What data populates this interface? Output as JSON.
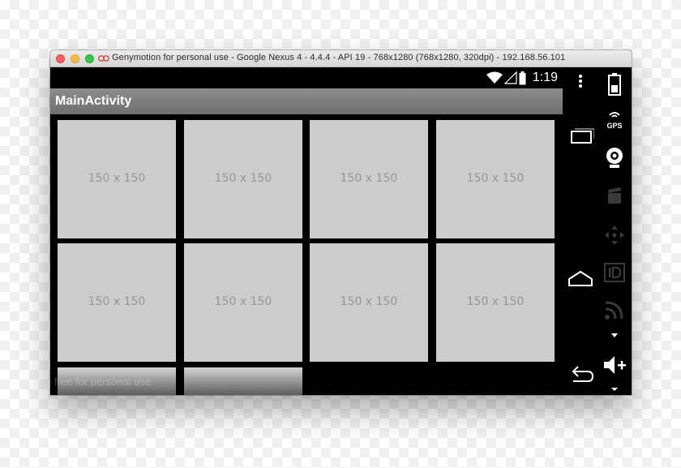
{
  "window": {
    "title": "Genymotion for personal use - Google Nexus 4 - 4.4.4 - API 19 - 768x1280 (768x1280, 320dpi) - 192.168.56.101"
  },
  "statusbar": {
    "time": "1:19",
    "icons": [
      "wifi-icon",
      "signal-icon",
      "battery-icon"
    ]
  },
  "app": {
    "title": "MainActivity",
    "tiles": [
      {
        "label": "150 x 150"
      },
      {
        "label": "150 x 150"
      },
      {
        "label": "150 x 150"
      },
      {
        "label": "150 x 150"
      },
      {
        "label": "150 x 150"
      },
      {
        "label": "150 x 150"
      },
      {
        "label": "150 x 150"
      },
      {
        "label": "150 x 150"
      },
      {
        "label": ""
      },
      {
        "label": ""
      }
    ],
    "watermark": "free for personal use"
  },
  "navbar": {
    "buttons": [
      "recent-apps-icon",
      "home-icon",
      "back-icon"
    ],
    "menu": "overflow-menu-icon"
  },
  "toolbar": {
    "gps_label": "GPS",
    "tools": [
      "battery-icon",
      "gps-icon",
      "camera-icon",
      "video-icon",
      "dpad-icon",
      "id-icon",
      "rss-icon",
      "volume-up-icon"
    ]
  },
  "colors": {
    "tile": "#cccccc",
    "tile_text": "#969696",
    "actionbar": "#7d7d7d",
    "screen": "#000000"
  }
}
